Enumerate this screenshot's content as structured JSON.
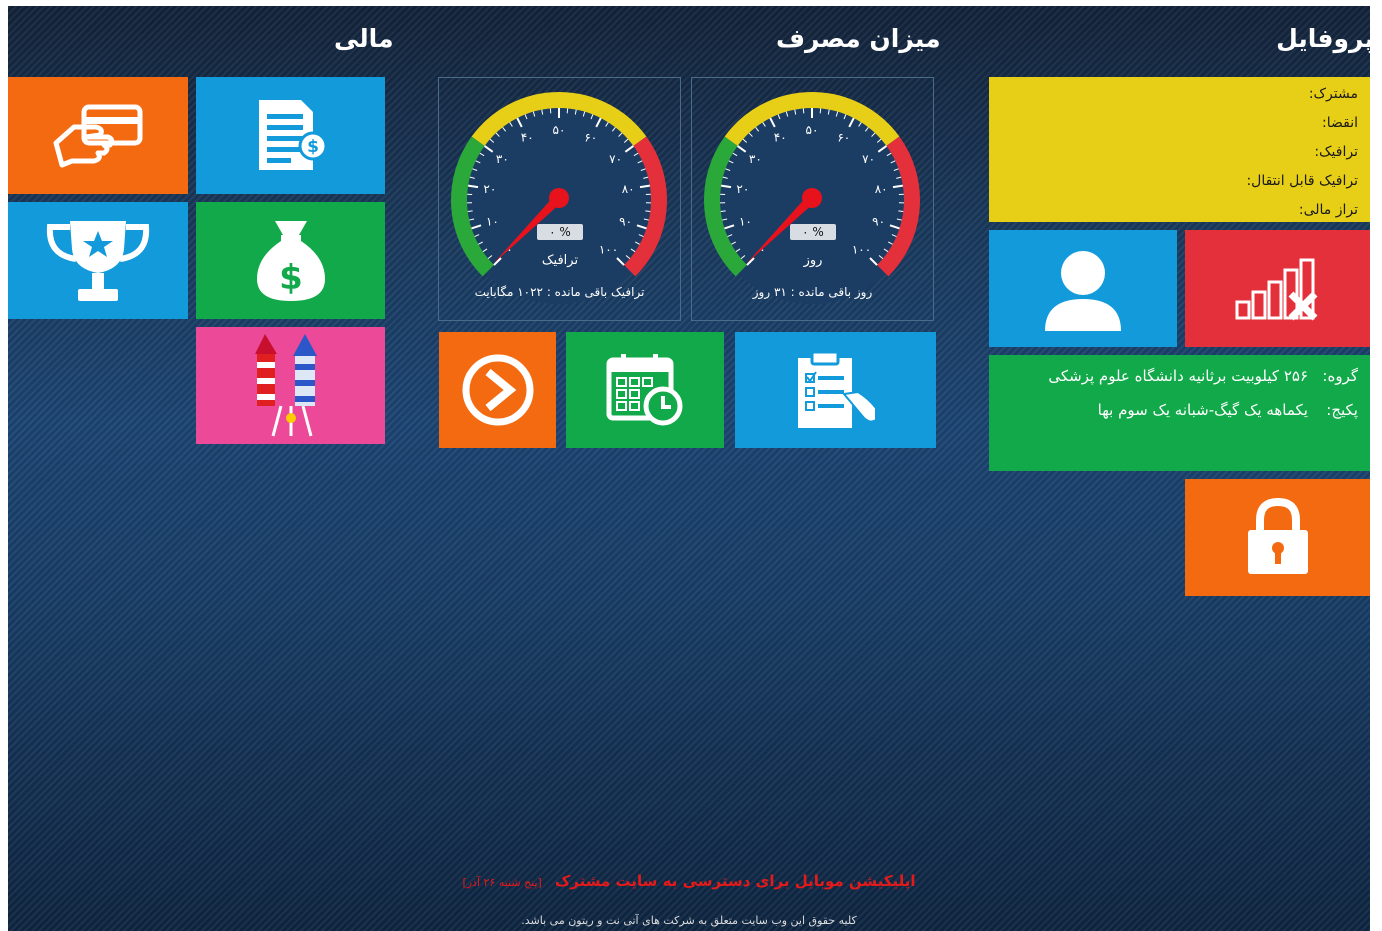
{
  "headings": {
    "profile": "پروفایل",
    "usage": "میزان مصرف",
    "finance": "مالی"
  },
  "profile_info": {
    "subscriber_label": "مشترک:",
    "expiry_label": "انقضا:",
    "traffic_label": "ترافیک:",
    "transferable_label": "ترافیک قابل انتقال:",
    "balance_label": "تراز مالی:"
  },
  "group_info": {
    "group_label": "گروه:",
    "group_value": "۲۵۶ کیلوبیت برثانیه دانشگاه علوم پزشکی",
    "package_label": "پکیج:",
    "package_value": "یکماهه یک گیگ-شبانه یک سوم بها"
  },
  "gauges": {
    "ticks": [
      "۰",
      "۱۰",
      "۲۰",
      "۳۰",
      "۴۰",
      "۵۰",
      "۶۰",
      "۷۰",
      "۸۰",
      "۹۰",
      "۱۰۰"
    ],
    "traffic": {
      "label": "ترافیک",
      "percent_text": "۰ %",
      "percent": 0,
      "caption": "ترافیک باقی مانده : ۱۰۲۲ مگابایت"
    },
    "days": {
      "label": "روز",
      "percent_text": "۰ %",
      "percent": 0,
      "caption": "روز باقی مانده : ۳۱ روز"
    }
  },
  "colors": {
    "orange": "#f46a10",
    "blue": "#129adb",
    "green": "#12a94a",
    "pink": "#ec4a98",
    "red": "#e3303a",
    "yellow": "#e8cf17",
    "footer_link": "#e41a1a"
  },
  "footer": {
    "app_link": "اپلیکیشن موبایل برای دسترسی به سایت مشترک",
    "app_date": "[پنج شنبه ۲۶ آذر]",
    "copyright": "کلیه حقوق این وب سایت متعلق به شرکت های آتی نت و ریتون می باشد."
  }
}
